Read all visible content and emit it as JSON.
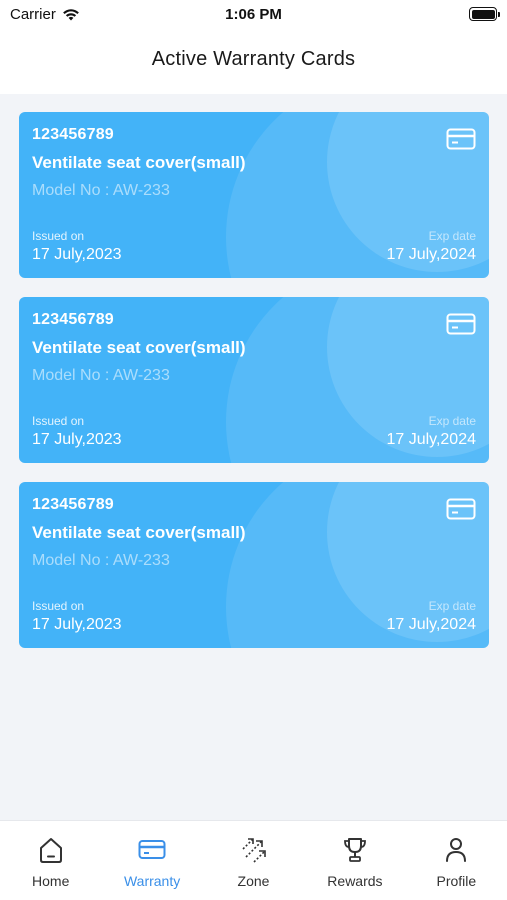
{
  "status_bar": {
    "carrier": "Carrier",
    "time": "1:06 PM"
  },
  "header": {
    "title": "Active Warranty Cards"
  },
  "cards": [
    {
      "number": "123456789",
      "product": "Ventilate seat cover(small)",
      "model": "Model No : AW-233",
      "issued_label": "Issued on",
      "issued_date": "17 July,2023",
      "exp_label": "Exp date",
      "exp_date": "17 July,2024",
      "icon": "credit-card-icon"
    },
    {
      "number": "123456789",
      "product": "Ventilate seat cover(small)",
      "model": "Model No : AW-233",
      "issued_label": "Issued on",
      "issued_date": "17 July,2023",
      "exp_label": "Exp date",
      "exp_date": "17 July,2024",
      "icon": "credit-card-icon"
    },
    {
      "number": "123456789",
      "product": "Ventilate seat cover(small)",
      "model": "Model No : AW-233",
      "issued_label": "Issued on",
      "issued_date": "17 July,2023",
      "exp_label": "Exp date",
      "exp_date": "17 July,2024",
      "icon": "credit-card-icon"
    }
  ],
  "tab_bar": {
    "items": [
      {
        "label": "Home",
        "icon": "home-icon",
        "active": false
      },
      {
        "label": "Warranty",
        "icon": "credit-card-icon",
        "active": true
      },
      {
        "label": "Zone",
        "icon": "zone-arrows-icon",
        "active": false
      },
      {
        "label": "Rewards",
        "icon": "trophy-icon",
        "active": false
      },
      {
        "label": "Profile",
        "icon": "profile-icon",
        "active": false
      }
    ]
  },
  "colors": {
    "card_background": "#43b3f8",
    "accent": "#3a8fe8",
    "page_background": "#f2f4f8"
  }
}
